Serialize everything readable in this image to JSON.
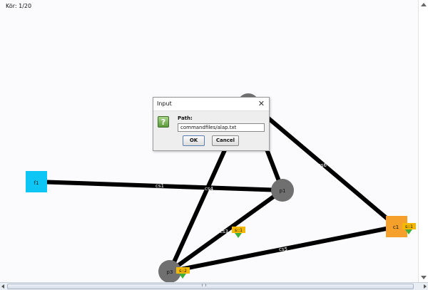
{
  "status": {
    "round_label": "Kör: 1/20"
  },
  "graph": {
    "nodes": [
      {
        "id": "f1",
        "label": "f1",
        "shape": "square",
        "color": "#0ec6f5"
      },
      {
        "id": "p1",
        "label": "p1",
        "shape": "circle",
        "color": "#707070"
      },
      {
        "id": "p2",
        "label": "",
        "shape": "circle",
        "color": "#707070"
      },
      {
        "id": "p3",
        "label": "p3",
        "shape": "circle",
        "color": "#707070"
      },
      {
        "id": "c1",
        "label": "c1",
        "shape": "square",
        "color": "#f4a02a"
      }
    ],
    "edges": [
      {
        "id": "cs1",
        "label": "cs1"
      },
      {
        "id": "cs2",
        "label": ""
      },
      {
        "id": "cs3",
        "label": "cs3"
      },
      {
        "id": "cs4",
        "label": "cs4"
      },
      {
        "id": "cs5",
        "label": "cs5"
      },
      {
        "id": "cs6",
        "label": "cs6"
      },
      {
        "id": "cs7",
        "label": ""
      }
    ],
    "tags": [
      {
        "id": "tag-cs3",
        "text": "s::1"
      },
      {
        "id": "tag-p3",
        "text": "s::2"
      },
      {
        "id": "tag-c1",
        "text": "s::1"
      }
    ],
    "edge_color": "#000000",
    "tag_color": "#f5b800",
    "marker_color": "#3fae3a"
  },
  "dialog": {
    "title": "Input",
    "close_glyph": "✕",
    "icon_glyph": "?",
    "path_label": "Path:",
    "path_value": "commandfiles/alap.txt",
    "ok_label": "OK",
    "cancel_label": "Cancel"
  }
}
